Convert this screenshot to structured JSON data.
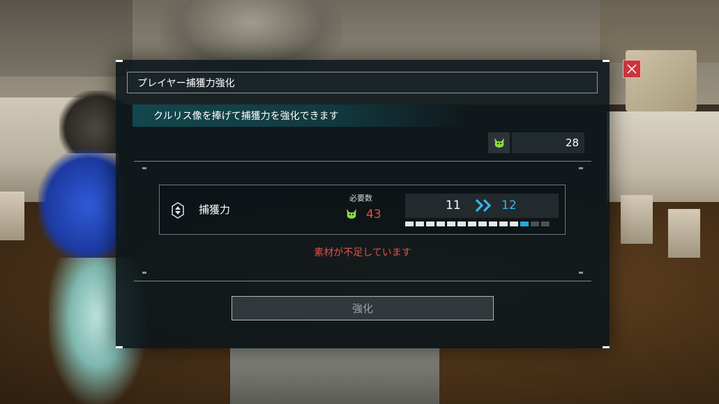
{
  "dialog": {
    "title": "プレイヤー捕獲力強化",
    "subtitle": "クルリス像を捧げて捕獲力を強化できます",
    "owned": {
      "icon": "lifmunk-effigy-icon",
      "value": "28"
    }
  },
  "stat": {
    "icon": "capture-power-icon",
    "label": "捕獲力",
    "required_label": "必要数",
    "required_icon": "lifmunk-effigy-icon",
    "required_value": "43",
    "level_current": "11",
    "level_next": "12",
    "progress": {
      "filled": 11,
      "next": 1,
      "total": 14
    }
  },
  "warning": "素材が不足しています",
  "enhance_button": "強化",
  "colors": {
    "accent": "#33b8e8",
    "warning": "#e0504a",
    "close": "#c9363c",
    "effigy": "#8fdc3a"
  }
}
